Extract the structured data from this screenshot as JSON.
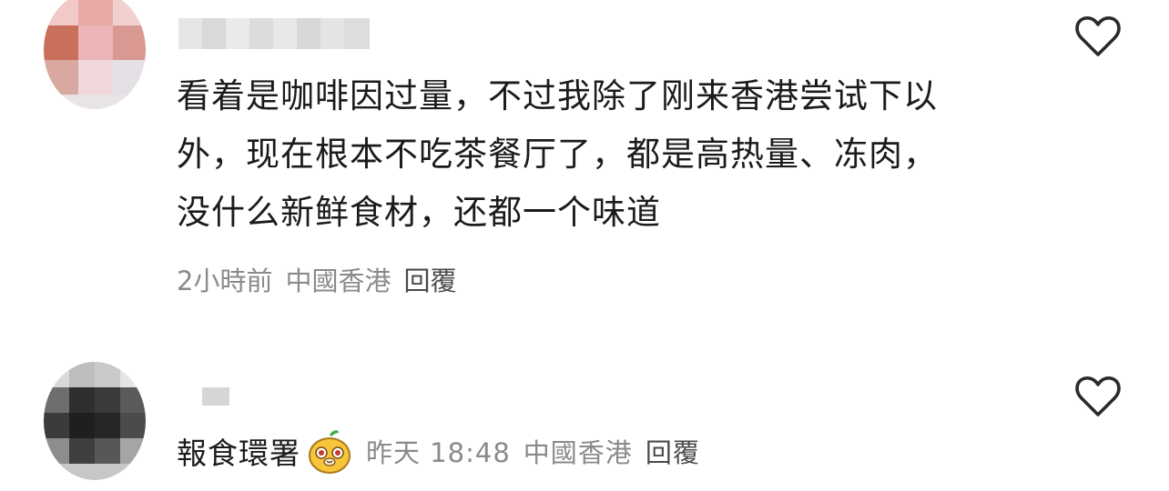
{
  "comments": [
    {
      "text": "看着是咖啡因过量，不过我除了刚来香港尝试下以\n外，现在根本不吃茶餐厅了，都是高热量、冻肉，\n没什么新鲜食材，还都一个味道",
      "time": "2小時前",
      "location": "中國香港",
      "reply_label": "回覆"
    },
    {
      "text": "報食環署",
      "emoji": "pear-face-emoji",
      "time": "昨天 18:48",
      "location": "中國香港",
      "reply_label": "回覆"
    }
  ],
  "icons": {
    "like": "heart-outline-icon"
  }
}
